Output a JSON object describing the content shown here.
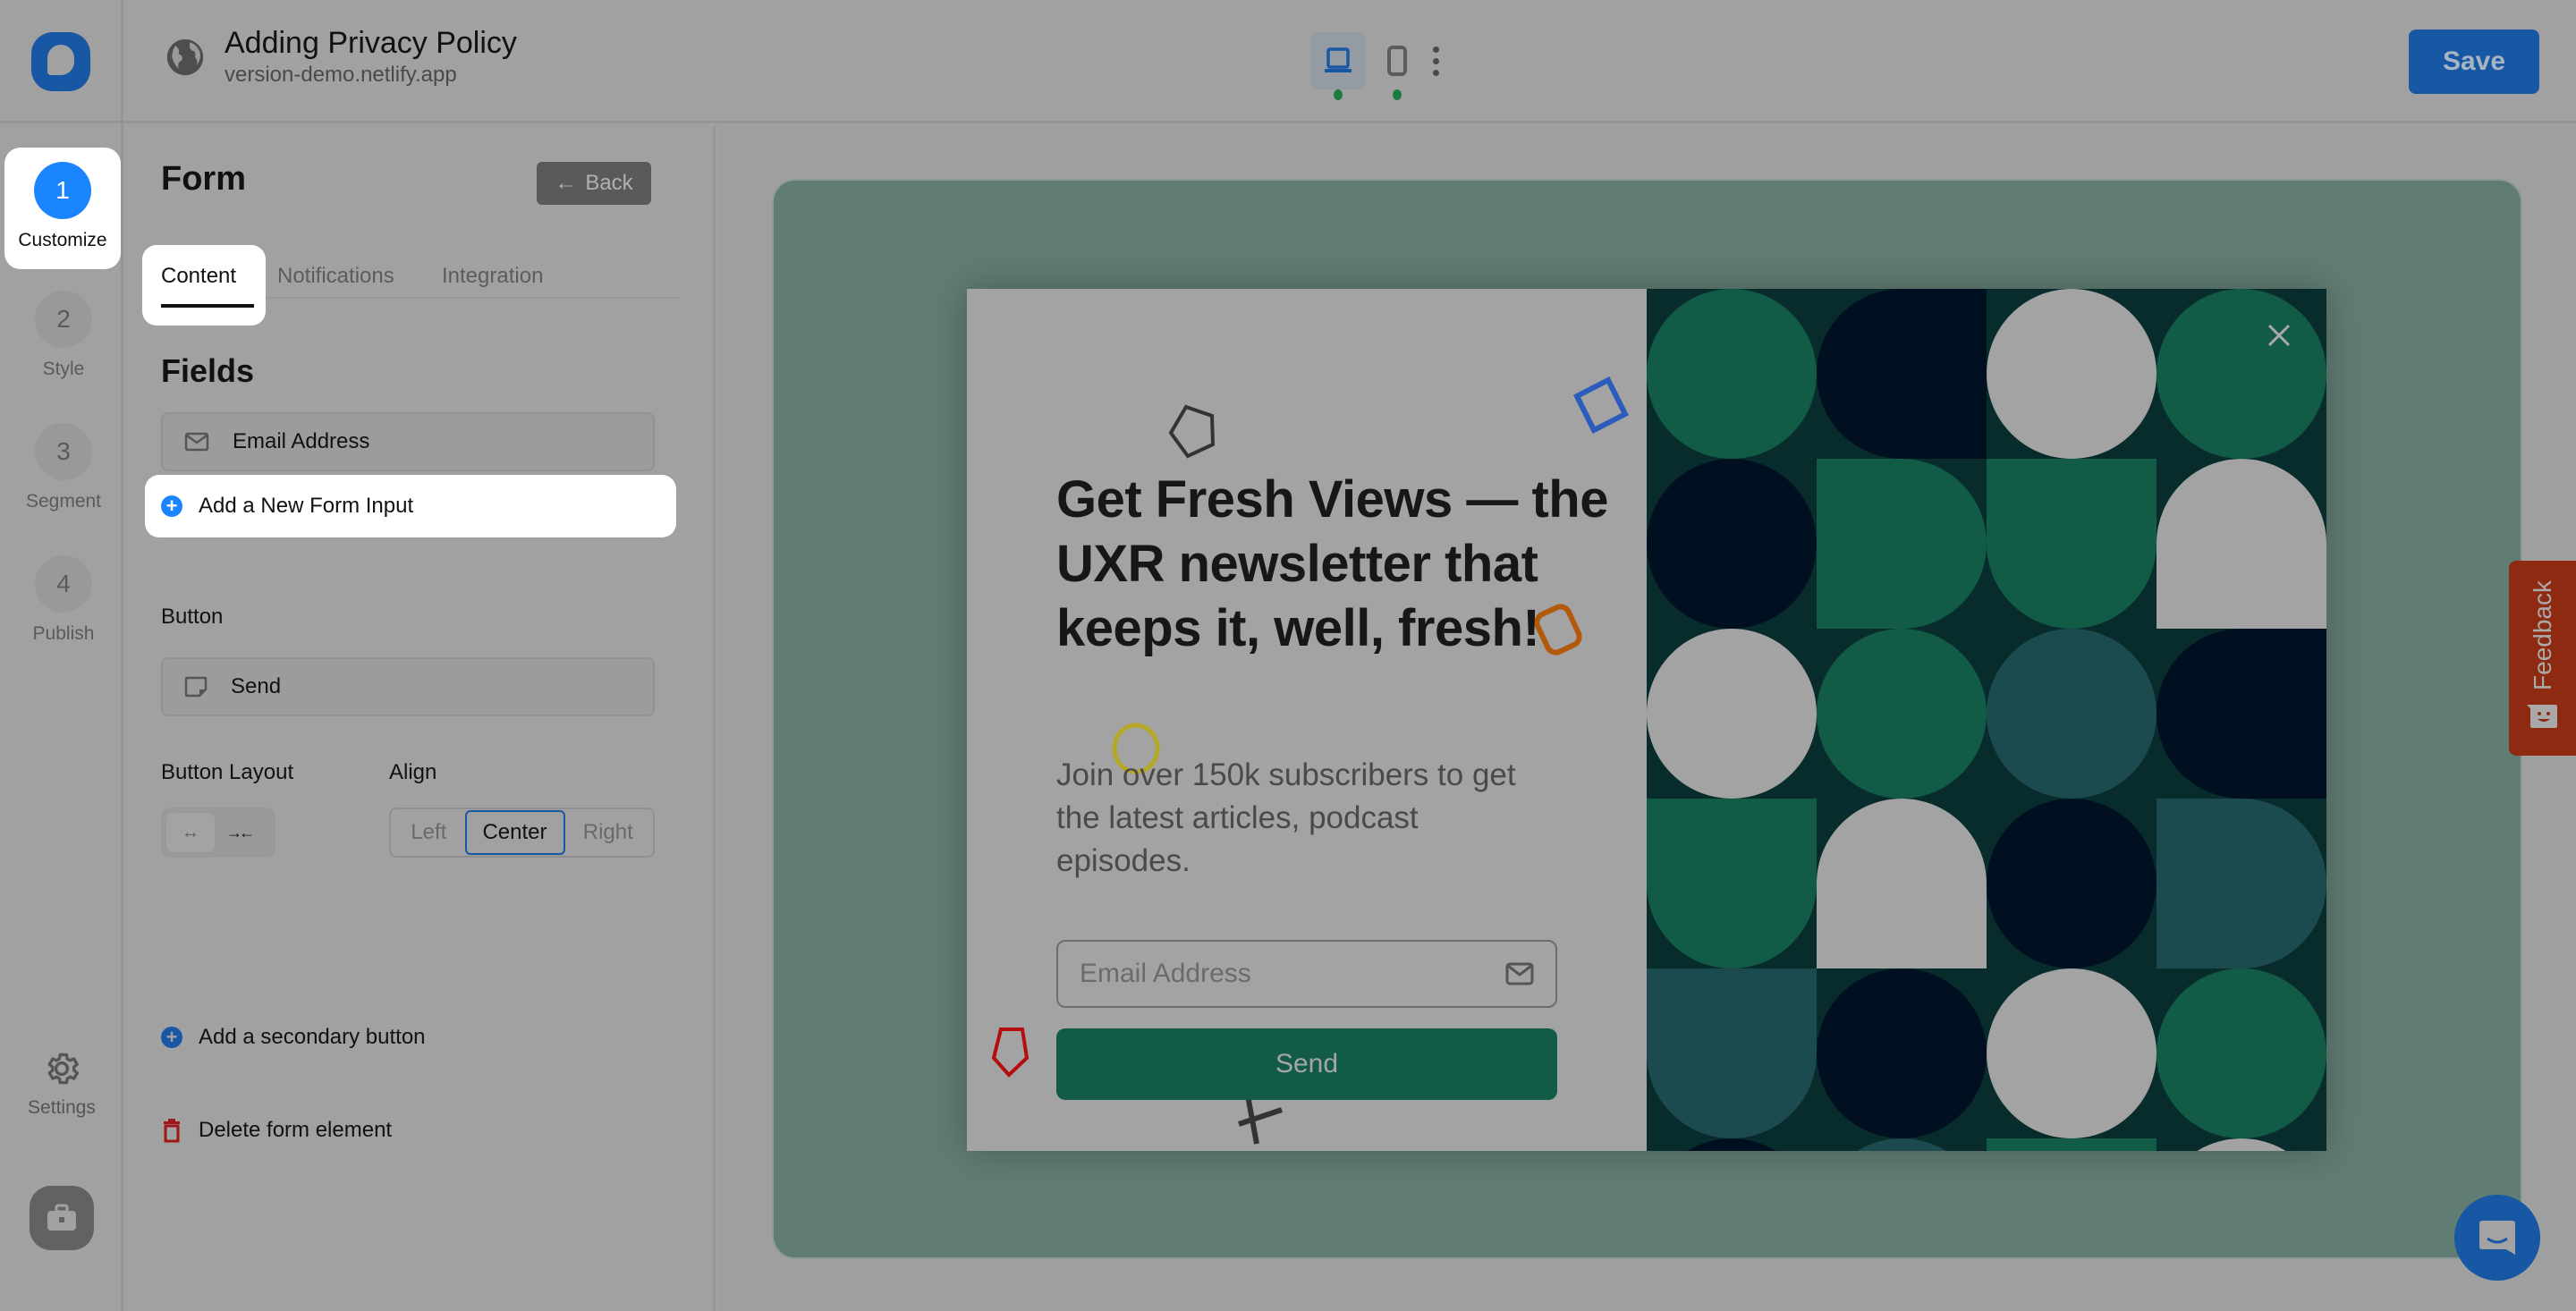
{
  "header": {
    "title": "Adding Privacy Policy",
    "subtitle": "version-demo.netlify.app",
    "save_label": "Save",
    "devices": [
      {
        "name": "desktop",
        "active": true
      },
      {
        "name": "mobile",
        "active": false
      }
    ]
  },
  "rail": {
    "steps": [
      {
        "number": "1",
        "label": "Customize",
        "active": true
      },
      {
        "number": "2",
        "label": "Style",
        "active": false
      },
      {
        "number": "3",
        "label": "Segment",
        "active": false
      },
      {
        "number": "4",
        "label": "Publish",
        "active": false
      }
    ],
    "settings_label": "Settings"
  },
  "panel": {
    "title": "Form",
    "back_label": "Back",
    "tabs": [
      {
        "label": "Content",
        "active": true
      },
      {
        "label": "Notifications",
        "active": false
      },
      {
        "label": "Integration",
        "active": false
      }
    ],
    "fields_title": "Fields",
    "fields": [
      {
        "label": "Email Address",
        "icon": "mail-icon"
      }
    ],
    "add_input_label": "Add a New Form Input",
    "button_section_label": "Button",
    "button_field": {
      "label": "Send",
      "icon": "sticky-note-icon"
    },
    "button_layout_label": "Button Layout",
    "button_layout_options": [
      {
        "icon": "↔",
        "name": "full-width",
        "active": true
      },
      {
        "icon": "→←",
        "name": "compact",
        "active": false
      }
    ],
    "align_label": "Align",
    "align_options": [
      {
        "label": "Left",
        "active": false
      },
      {
        "label": "Center",
        "active": true
      },
      {
        "label": "Right",
        "active": false
      }
    ],
    "add_secondary_label": "Add a secondary button",
    "delete_label": "Delete form element"
  },
  "preview": {
    "headline": "Get Fresh Views — the UXR newsletter that keeps it, well, fresh!",
    "body": "Join over 150k subscribers to get the latest articles, podcast episodes.",
    "email_placeholder": "Email Address",
    "send_label": "Send",
    "pattern_colors": {
      "background": "#082b2c",
      "green": "#115b47",
      "navy": "#001020",
      "teal": "#1b4b4e",
      "light": "#a3a3a3"
    }
  },
  "feedback_label": "Feedback",
  "colors": {
    "brand": "#1757a3",
    "active_step": "#1a85ff",
    "delete": "#a01515",
    "feedback": "#8e2a12",
    "status_dot": "#1b7a3d"
  }
}
